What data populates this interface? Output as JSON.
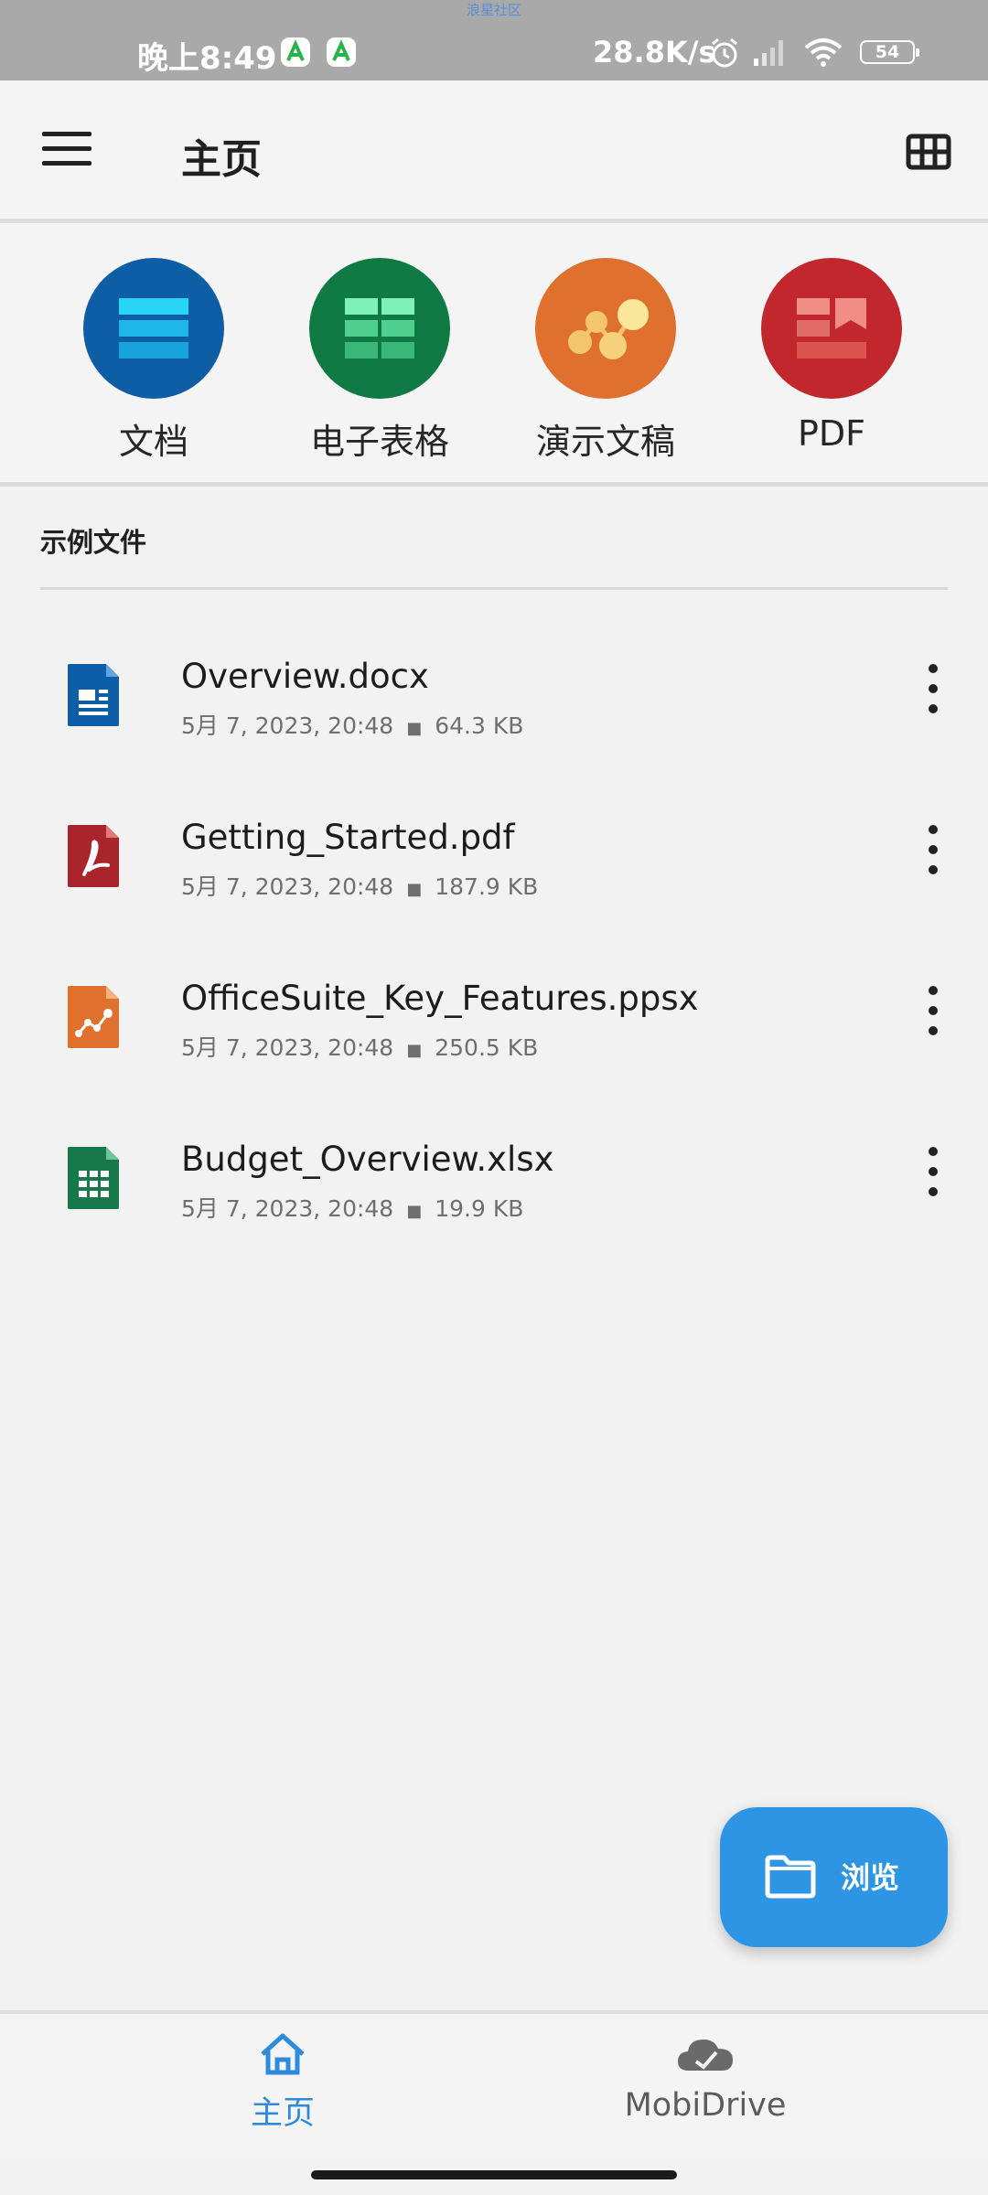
{
  "status_bar": {
    "top_label": "浪星社区",
    "time": "晚上8:49",
    "network_speed": "28.8K/s",
    "battery": "54",
    "icons": [
      "app-notification-icon",
      "app-notification-icon",
      "alarm-icon",
      "signal-icon",
      "wifi-icon",
      "battery-icon"
    ]
  },
  "app_bar": {
    "title": "主页",
    "menu_icon": "hamburger-menu-icon",
    "view_icon": "grid-view-icon"
  },
  "categories": [
    {
      "label": "文档",
      "color": "#0e5ea6",
      "icon": "document-icon"
    },
    {
      "label": "电子表格",
      "color": "#0f7a43",
      "icon": "spreadsheet-icon"
    },
    {
      "label": "演示文稿",
      "color": "#e0702e",
      "icon": "presentation-icon"
    },
    {
      "label": "PDF",
      "color": "#c1272d",
      "icon": "pdf-icon"
    }
  ],
  "section": {
    "title": "示例文件"
  },
  "files": [
    {
      "name": "Overview.docx",
      "date": "5月 7, 2023, 20:48",
      "size": "64.3 KB",
      "icon": "docx-file-icon"
    },
    {
      "name": "Getting_Started.pdf",
      "date": "5月 7, 2023, 20:48",
      "size": "187.9 KB",
      "icon": "pdf-file-icon"
    },
    {
      "name": "OfficeSuite_Key_Features.ppsx",
      "date": "5月 7, 2023, 20:48",
      "size": "250.5 KB",
      "icon": "ppsx-file-icon"
    },
    {
      "name": "Budget_Overview.xlsx",
      "date": "5月 7, 2023, 20:48",
      "size": "19.9 KB",
      "icon": "xlsx-file-icon"
    }
  ],
  "fab": {
    "label": "浏览",
    "icon": "folder-icon"
  },
  "bottom_nav": [
    {
      "label": "主页",
      "active": true,
      "icon": "home-icon"
    },
    {
      "label": "MobiDrive",
      "active": false,
      "icon": "cloud-icon"
    }
  ],
  "colors": {
    "accent": "#2e95e4",
    "background": "#f2f2f2"
  }
}
